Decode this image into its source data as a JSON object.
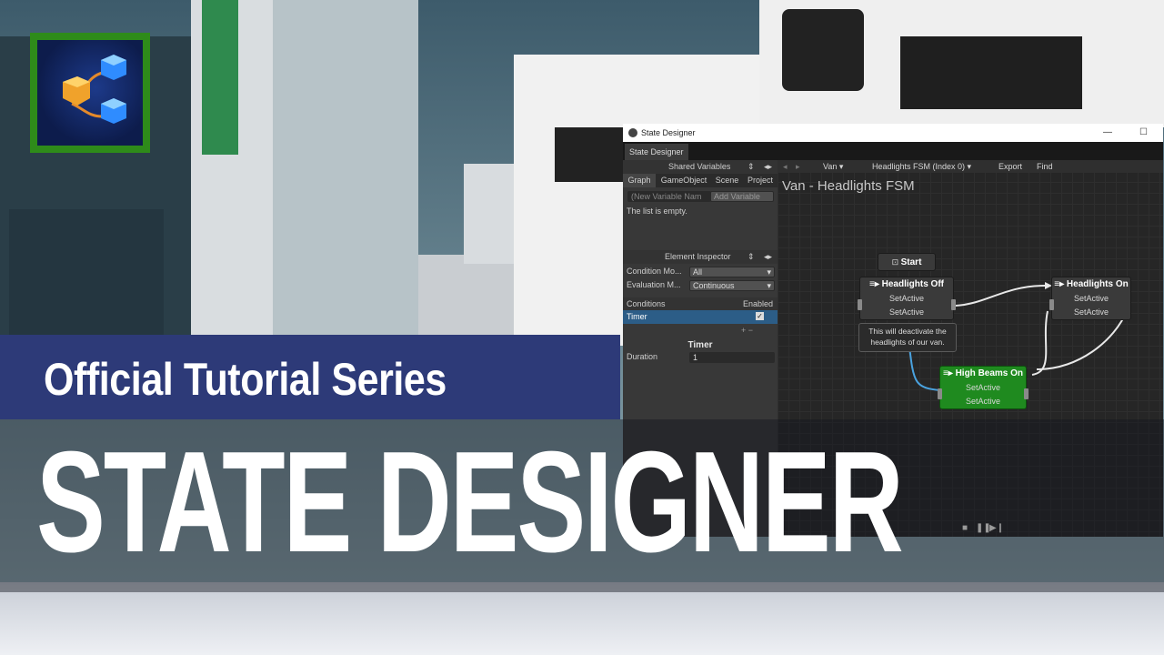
{
  "window": {
    "title": "State Designer",
    "tab": "State Designer"
  },
  "left_panel": {
    "shared_variables_label": "Shared Variables",
    "tabs": [
      "Graph",
      "GameObject",
      "Scene",
      "Project"
    ],
    "new_variable_placeholder": "(New Variable Nam",
    "add_variable_label": "Add Variable",
    "empty_list_text": "The list is empty.",
    "element_inspector_label": "Element Inspector",
    "condition_mode": {
      "label": "Condition Mo...",
      "value": "All"
    },
    "evaluation_mode": {
      "label": "Evaluation M...",
      "value": "Continuous"
    },
    "conditions_header": "Conditions",
    "enabled_header": "Enabled",
    "condition_item": "Timer",
    "add_remove": "+ −",
    "timer_section_title": "Timer",
    "duration": {
      "label": "Duration",
      "value": "1"
    }
  },
  "graph_toolbar": {
    "object": "Van",
    "fsm": "Headlights FSM (Index 0)",
    "export_label": "Export",
    "find_label": "Find"
  },
  "graph": {
    "title": "Van - Headlights FSM",
    "start_label": "Start",
    "nodes": {
      "headlights_off": {
        "title": "Headlights Off",
        "actions": [
          "SetActive",
          "SetActive"
        ]
      },
      "headlights_on": {
        "title": "Headlights On",
        "actions": [
          "SetActive",
          "SetActive"
        ]
      },
      "high_beams_on": {
        "title": "High Beams On",
        "actions": [
          "SetActive",
          "SetActive"
        ]
      }
    },
    "note": "This will deactivate the headlights of our van."
  },
  "overlay": {
    "subtitle": "Official Tutorial Series",
    "headline": "STATE DESIGNER"
  },
  "colors": {
    "banner": "#2d3a78",
    "active_node": "#1f8a1f",
    "selection": "#2c5d87",
    "logo_frame": "#2e8b1a"
  }
}
